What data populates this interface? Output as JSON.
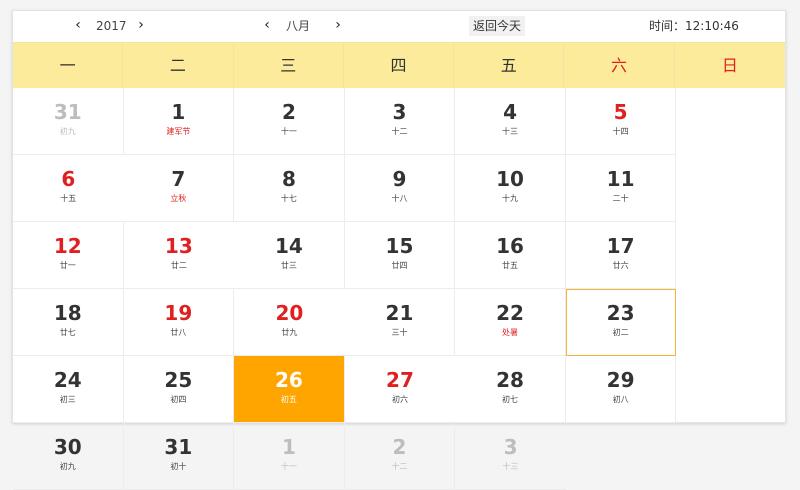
{
  "toolbar": {
    "year_value": "2017",
    "month_value": "八月",
    "prev_symbol": "‹",
    "next_symbol": "›",
    "today_label": "返回今天",
    "time_label": "时间：",
    "time_value": "12:10:46"
  },
  "weekdays": [
    {
      "label": "一",
      "weekend": false
    },
    {
      "label": "二",
      "weekend": false
    },
    {
      "label": "三",
      "weekend": false
    },
    {
      "label": "四",
      "weekend": false
    },
    {
      "label": "五",
      "weekend": false
    },
    {
      "label": "六",
      "weekend": true
    },
    {
      "label": "日",
      "weekend": true
    }
  ],
  "days": [
    {
      "day": "31",
      "lunar": "初九",
      "state": "other"
    },
    {
      "day": "1",
      "lunar": "建军节",
      "state": "holiday"
    },
    {
      "day": "2",
      "lunar": "十一",
      "state": ""
    },
    {
      "day": "3",
      "lunar": "十二",
      "state": ""
    },
    {
      "day": "4",
      "lunar": "十三",
      "state": ""
    },
    {
      "day": "5",
      "lunar": "十四",
      "state": "weekend"
    },
    {
      "day": "6",
      "lunar": "十五",
      "state": "weekend"
    },
    {
      "day": "7",
      "lunar": "立秋",
      "state": "holiday"
    },
    {
      "day": "8",
      "lunar": "十七",
      "state": ""
    },
    {
      "day": "9",
      "lunar": "十八",
      "state": ""
    },
    {
      "day": "10",
      "lunar": "十九",
      "state": ""
    },
    {
      "day": "11",
      "lunar": "二十",
      "state": ""
    },
    {
      "day": "12",
      "lunar": "廿一",
      "state": "weekend"
    },
    {
      "day": "13",
      "lunar": "廿二",
      "state": "weekend"
    },
    {
      "day": "14",
      "lunar": "廿三",
      "state": ""
    },
    {
      "day": "15",
      "lunar": "廿四",
      "state": ""
    },
    {
      "day": "16",
      "lunar": "廿五",
      "state": ""
    },
    {
      "day": "17",
      "lunar": "廿六",
      "state": ""
    },
    {
      "day": "18",
      "lunar": "廿七",
      "state": ""
    },
    {
      "day": "19",
      "lunar": "廿八",
      "state": "weekend"
    },
    {
      "day": "20",
      "lunar": "廿九",
      "state": "weekend"
    },
    {
      "day": "21",
      "lunar": "三十",
      "state": ""
    },
    {
      "day": "22",
      "lunar": "处暑",
      "state": "holiday"
    },
    {
      "day": "23",
      "lunar": "初二",
      "state": "today"
    },
    {
      "day": "24",
      "lunar": "初三",
      "state": ""
    },
    {
      "day": "25",
      "lunar": "初四",
      "state": ""
    },
    {
      "day": "26",
      "lunar": "初五",
      "state": "selected"
    },
    {
      "day": "27",
      "lunar": "初六",
      "state": "weekend"
    },
    {
      "day": "28",
      "lunar": "初七",
      "state": ""
    },
    {
      "day": "29",
      "lunar": "初八",
      "state": ""
    },
    {
      "day": "30",
      "lunar": "初九",
      "state": ""
    },
    {
      "day": "31",
      "lunar": "初十",
      "state": ""
    },
    {
      "day": "1",
      "lunar": "十一",
      "state": "other"
    },
    {
      "day": "2",
      "lunar": "十二",
      "state": "other"
    },
    {
      "day": "3",
      "lunar": "十三",
      "state": "other"
    }
  ],
  "colors": {
    "header_bg": "#fbeb9b",
    "weekend_red": "#e02020",
    "selected_bg": "#ffa500",
    "today_border": "#f3b33c",
    "other_month_gray": "#bdbdbd"
  }
}
